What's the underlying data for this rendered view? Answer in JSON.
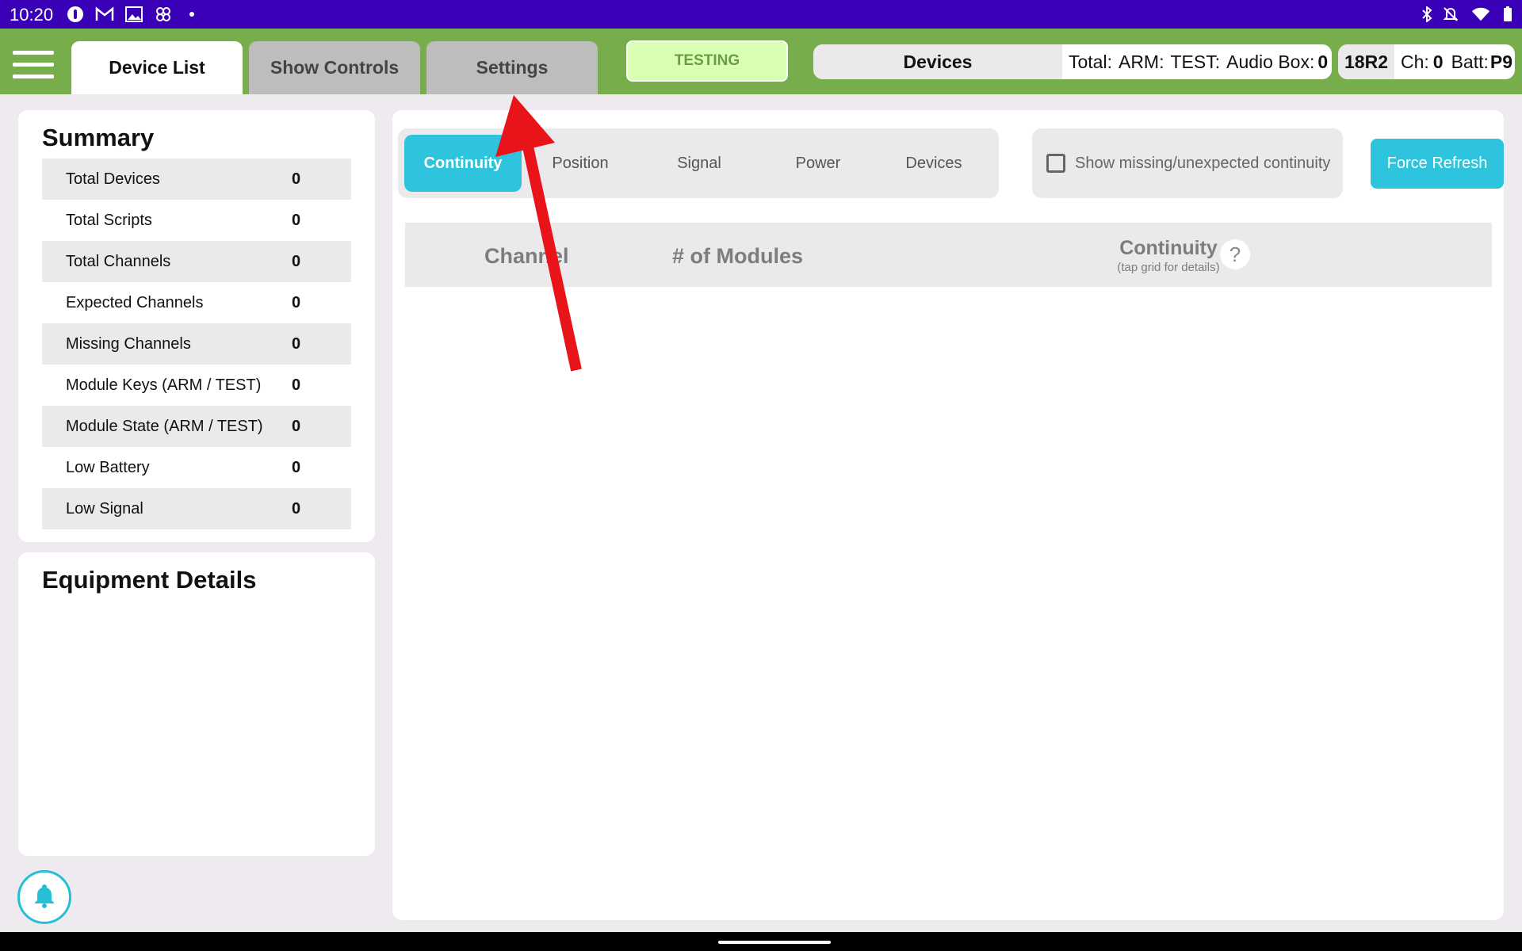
{
  "status_bar": {
    "time": "10:20",
    "left_icons": [
      "alert-icon",
      "gmail-icon",
      "photo-icon",
      "pinwheel-icon",
      "dot-icon"
    ],
    "right_icons": [
      "bluetooth-icon",
      "silent-bell-icon",
      "wifi-icon",
      "battery-icon"
    ]
  },
  "app_bar": {
    "menu_icon": "hamburger-icon",
    "tabs": [
      {
        "label": "Device List",
        "active": true
      },
      {
        "label": "Show Controls",
        "active": false
      },
      {
        "label": "Settings",
        "active": false
      }
    ],
    "mode_button": "TESTING",
    "devices": {
      "title": "Devices",
      "total_label": "Total:",
      "arm_label": "ARM:",
      "test_label": "TEST:",
      "audio_label": "Audio Box:",
      "audio_value": "0"
    },
    "receiver": {
      "id": "18R2",
      "ch_label": "Ch:",
      "ch_value": "0",
      "batt_label": "Batt:",
      "batt_value": "P9"
    }
  },
  "summary": {
    "title": "Summary",
    "rows": [
      {
        "label": "Total Devices",
        "value": "0"
      },
      {
        "label": "Total Scripts",
        "value": "0"
      },
      {
        "label": "Total Channels",
        "value": "0"
      },
      {
        "label": "Expected Channels",
        "value": "0"
      },
      {
        "label": "Missing Channels",
        "value": "0"
      },
      {
        "label": "Module Keys (ARM / TEST)",
        "value": "0"
      },
      {
        "label": "Module State (ARM / TEST)",
        "value": "0"
      },
      {
        "label": "Low Battery",
        "value": "0"
      },
      {
        "label": "Low Signal",
        "value": "0"
      }
    ]
  },
  "equipment": {
    "title": "Equipment Details"
  },
  "main": {
    "segments": [
      {
        "label": "Continuity",
        "active": true
      },
      {
        "label": "Position",
        "active": false
      },
      {
        "label": "Signal",
        "active": false
      },
      {
        "label": "Power",
        "active": false
      },
      {
        "label": "Devices",
        "active": false
      }
    ],
    "show_missing": {
      "label": "Show missing/unexpected continuity",
      "checked": false
    },
    "refresh_label": "Force Refresh",
    "table": {
      "col_channel": "Channel",
      "col_modules": "# of Modules",
      "col_continuity": "Continuity",
      "continuity_hint": "(tap grid for details)",
      "help": "?"
    }
  },
  "colors": {
    "status_bar": "#3a00b8",
    "app_bar": "#77ad4a",
    "accent": "#2ec4dd",
    "testing_bg": "#d9ffb3",
    "annotation_arrow": "#e8141a"
  }
}
